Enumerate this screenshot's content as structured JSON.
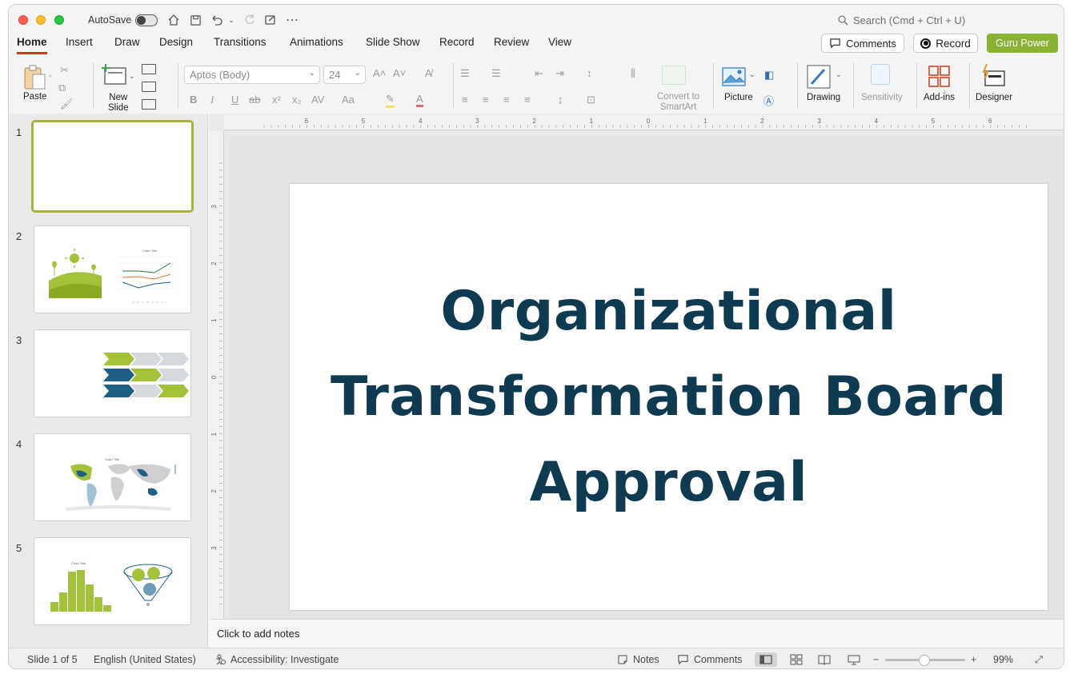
{
  "titlebar": {
    "autosave_label": "AutoSave",
    "search_placeholder": "Search (Cmd + Ctrl + U)"
  },
  "tabs": [
    {
      "label": "Home"
    },
    {
      "label": "Insert"
    },
    {
      "label": "Draw"
    },
    {
      "label": "Design"
    },
    {
      "label": "Transitions"
    },
    {
      "label": "Animations"
    },
    {
      "label": "Slide Show"
    },
    {
      "label": "Record"
    },
    {
      "label": "Review"
    },
    {
      "label": "View"
    }
  ],
  "header_buttons": {
    "comments": "Comments",
    "record": "Record",
    "guru": "Guru Power"
  },
  "ribbon": {
    "paste": "Paste",
    "new_slide_line1": "New",
    "new_slide_line2": "Slide",
    "font_name": "Aptos (Body)",
    "font_size": "24",
    "convert_line1": "Convert to",
    "convert_line2": "SmartArt",
    "picture": "Picture",
    "drawing": "Drawing",
    "sensitivity": "Sensitivity",
    "addins": "Add-ins",
    "designer": "Designer"
  },
  "thumbnails": {
    "numbers": [
      "1",
      "2",
      "3",
      "4",
      "5"
    ],
    "selected": 1,
    "chart_title": "Chart Title"
  },
  "ruler": {
    "h_labels": [
      "6",
      "5",
      "4",
      "3",
      "2",
      "1",
      "0",
      "1",
      "2",
      "3",
      "4",
      "5",
      "6"
    ],
    "v_labels": [
      "3",
      "2",
      "1",
      "0",
      "1",
      "2",
      "3"
    ]
  },
  "slide": {
    "title_line1": "Organizational",
    "title_line2": "Transformation Board",
    "title_line3": "Approval",
    "title_color": "#0e3a52"
  },
  "notes": {
    "placeholder": "Click to add notes"
  },
  "status": {
    "slide_counter": "Slide 1 of 5",
    "language": "English (United States)",
    "accessibility": "Accessibility: Investigate",
    "notes": "Notes",
    "comments": "Comments",
    "zoom": "99%"
  },
  "colors": {
    "accent_tab": "#c43e1c",
    "guru_green": "#8ab234",
    "thumb_green": "#a3c13a",
    "thumb_blue": "#1f5f85"
  }
}
